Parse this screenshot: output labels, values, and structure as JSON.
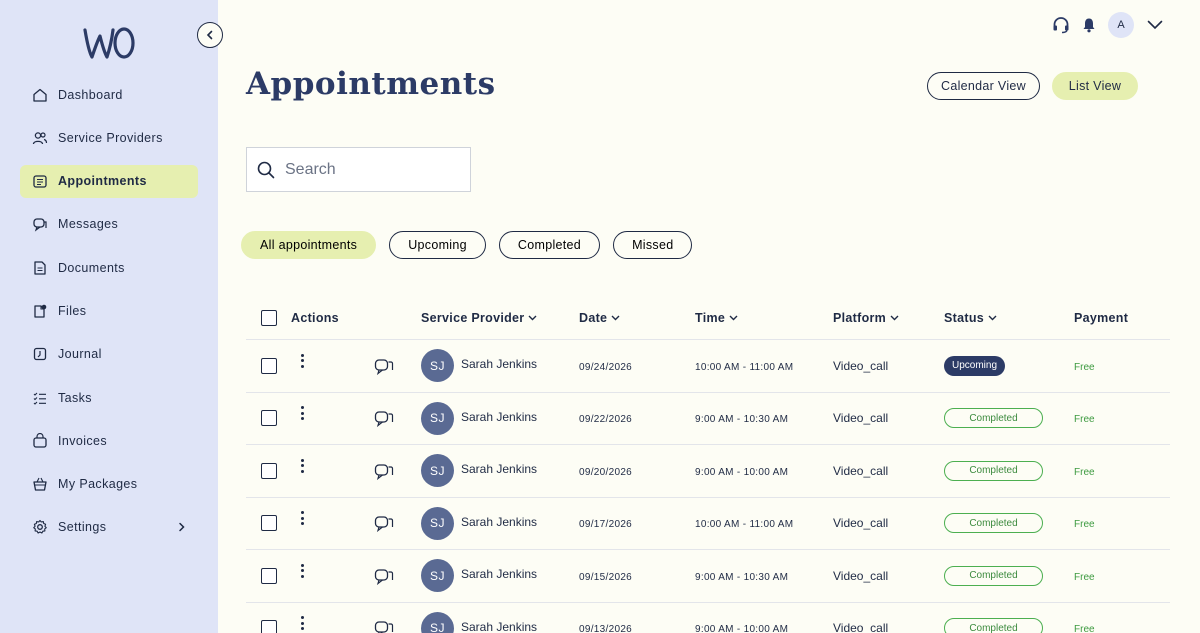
{
  "sidebar": {
    "items": [
      {
        "label": "Dashboard",
        "icon": "home-icon"
      },
      {
        "label": "Service Providers",
        "icon": "users-icon"
      },
      {
        "label": "Appointments",
        "icon": "calendar-icon",
        "active": true
      },
      {
        "label": "Messages",
        "icon": "chat-icon"
      },
      {
        "label": "Documents",
        "icon": "document-icon"
      },
      {
        "label": "Files",
        "icon": "files-icon"
      },
      {
        "label": "Journal",
        "icon": "journal-icon"
      },
      {
        "label": "Tasks",
        "icon": "tasks-icon"
      },
      {
        "label": "Invoices",
        "icon": "invoice-icon"
      },
      {
        "label": "My Packages",
        "icon": "basket-icon"
      },
      {
        "label": "Settings",
        "icon": "gear-icon"
      }
    ]
  },
  "header": {
    "avatar_initial": "A",
    "title": "Appointments",
    "calendar_view": "Calendar View",
    "list_view": "List View"
  },
  "search": {
    "placeholder": "Search"
  },
  "filters": [
    "All appointments",
    "Upcoming",
    "Completed",
    "Missed"
  ],
  "table": {
    "headers": {
      "actions": "Actions",
      "service_provider": "Service Provider",
      "date": "Date",
      "time": "Time",
      "platform": "Platform",
      "status": "Status",
      "payment": "Payment"
    },
    "rows": [
      {
        "initials": "SJ",
        "provider": "Sarah Jenkins",
        "date": "09/24/2026",
        "time": "10:00 AM - 11:00 AM",
        "platform": "Video_call",
        "status": "Upcoming",
        "payment": "Free"
      },
      {
        "initials": "SJ",
        "provider": "Sarah Jenkins",
        "date": "09/22/2026",
        "time": "9:00 AM - 10:30 AM",
        "platform": "Video_call",
        "status": "Completed",
        "payment": "Free"
      },
      {
        "initials": "SJ",
        "provider": "Sarah Jenkins",
        "date": "09/20/2026",
        "time": "9:00 AM - 10:00 AM",
        "platform": "Video_call",
        "status": "Completed",
        "payment": "Free"
      },
      {
        "initials": "SJ",
        "provider": "Sarah Jenkins",
        "date": "09/17/2026",
        "time": "10:00 AM - 11:00 AM",
        "platform": "Video_call",
        "status": "Completed",
        "payment": "Free"
      },
      {
        "initials": "SJ",
        "provider": "Sarah Jenkins",
        "date": "09/15/2026",
        "time": "9:00 AM - 10:30 AM",
        "platform": "Video_call",
        "status": "Completed",
        "payment": "Free"
      },
      {
        "initials": "SJ",
        "provider": "Sarah Jenkins",
        "date": "09/13/2026",
        "time": "9:00 AM - 10:00 AM",
        "platform": "Video_call",
        "status": "Completed",
        "payment": "Free"
      }
    ]
  },
  "colors": {
    "sidebar_bg": "#dfe4f7",
    "accent": "#e6efb0",
    "primary": "#2c3b66",
    "completed": "#4caf50"
  }
}
